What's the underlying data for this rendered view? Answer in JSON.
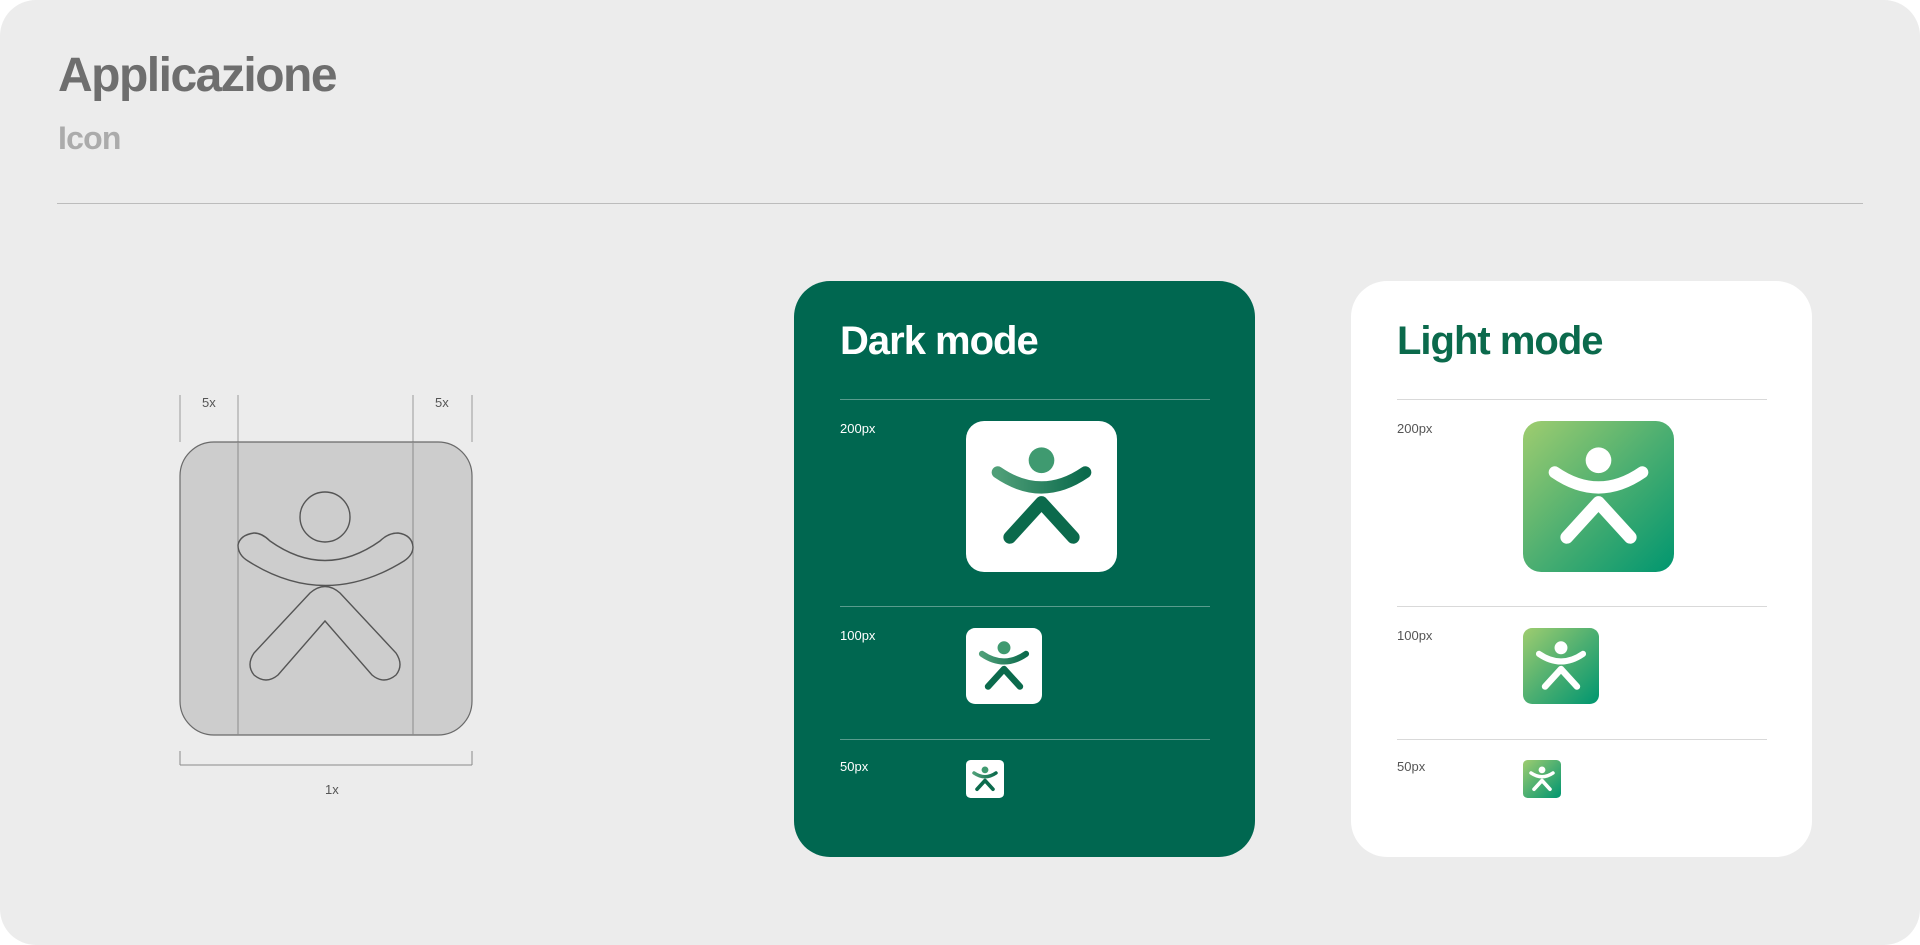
{
  "header": {
    "title": "Applicazione",
    "subtitle": "Icon"
  },
  "construction": {
    "margin_label_left": "5x",
    "margin_label_right": "5x",
    "width_label": "1x"
  },
  "dark_mode": {
    "title": "Dark mode",
    "sizes": [
      "200px",
      "100px",
      "50px"
    ]
  },
  "light_mode": {
    "title": "Light mode",
    "sizes": [
      "200px",
      "100px",
      "50px"
    ]
  },
  "colors": {
    "background": "#ececec",
    "dark_card": "#006750",
    "brand_green": "#0b6a4c",
    "gradient_start": "#9fcd6f",
    "gradient_end": "#00966f",
    "construction_fill": "#cdcdcd"
  },
  "icons": {
    "logo": "person-figure-icon"
  }
}
